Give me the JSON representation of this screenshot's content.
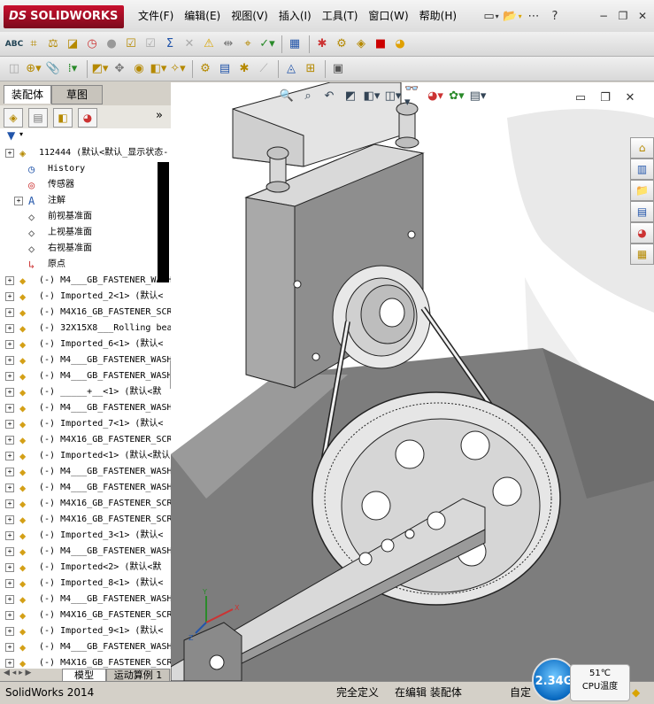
{
  "app": {
    "logo_prefix": "DS",
    "logo_text": "SOLIDWORKS"
  },
  "menus": [
    "文件(F)",
    "编辑(E)",
    "视图(V)",
    "插入(I)",
    "工具(T)",
    "窗口(W)",
    "帮助(H)"
  ],
  "title_tools": {
    "help": "?",
    "minimize": "−",
    "restore": "❐",
    "close": "✕"
  },
  "left_panel": {
    "tabs": [
      "装配体",
      "草图"
    ],
    "filter_icon": "filter-icon",
    "tree": [
      {
        "label": "112444  (默认<默认_显示状态-",
        "icon": "assembly-icon",
        "expand": "+"
      },
      {
        "label": "History",
        "icon": "history-icon",
        "expand": ""
      },
      {
        "label": "传感器",
        "icon": "sensor-icon",
        "expand": ""
      },
      {
        "label": "注解",
        "icon": "annotation-icon",
        "expand": "+"
      },
      {
        "label": "前视基准面",
        "icon": "plane-icon",
        "expand": ""
      },
      {
        "label": "上视基准面",
        "icon": "plane-icon",
        "expand": ""
      },
      {
        "label": "右视基准面",
        "icon": "plane-icon",
        "expand": ""
      },
      {
        "label": "原点",
        "icon": "origin-icon",
        "expand": ""
      },
      {
        "label": "(-) M4___GB_FASTENER_WASH",
        "icon": "part-icon",
        "expand": "+"
      },
      {
        "label": "(-) Imported_2<1> (默认<",
        "icon": "part-icon",
        "expand": "+"
      },
      {
        "label": "(-) M4X16_GB_FASTENER_SCR",
        "icon": "part-icon",
        "expand": "+"
      },
      {
        "label": "(-) 32X15X8___Rolling bea",
        "icon": "part-icon",
        "expand": "+"
      },
      {
        "label": "(-) Imported_6<1> (默认<",
        "icon": "part-icon",
        "expand": "+"
      },
      {
        "label": "(-) M4___GB_FASTENER_WASH",
        "icon": "part-icon",
        "expand": "+"
      },
      {
        "label": "(-) M4___GB_FASTENER_WASH",
        "icon": "part-icon",
        "expand": "+"
      },
      {
        "label": "(-) _____+__<1> (默认<默",
        "icon": "part-icon",
        "expand": "+"
      },
      {
        "label": "(-) M4___GB_FASTENER_WASH",
        "icon": "part-icon",
        "expand": "+"
      },
      {
        "label": "(-) Imported_7<1> (默认<",
        "icon": "part-icon",
        "expand": "+"
      },
      {
        "label": "(-) M4X16_GB_FASTENER_SCR",
        "icon": "part-icon",
        "expand": "+"
      },
      {
        "label": "(-) Imported<1> (默认<默认",
        "icon": "part-icon",
        "expand": "+"
      },
      {
        "label": "(-) M4___GB_FASTENER_WASH",
        "icon": "part-icon",
        "expand": "+"
      },
      {
        "label": "(-) M4___GB_FASTENER_WASH",
        "icon": "part-icon",
        "expand": "+"
      },
      {
        "label": "(-) M4X16_GB_FASTENER_SCR",
        "icon": "part-icon",
        "expand": "+"
      },
      {
        "label": "(-) M4X16_GB_FASTENER_SCR",
        "icon": "part-icon",
        "expand": "+"
      },
      {
        "label": "(-) Imported_3<1> (默认<",
        "icon": "part-icon",
        "expand": "+"
      },
      {
        "label": "(-) M4___GB_FASTENER_WASH",
        "icon": "part-icon",
        "expand": "+"
      },
      {
        "label": "(-) Imported<2> (默认<默",
        "icon": "part-icon",
        "expand": "+"
      },
      {
        "label": "(-) Imported_8<1> (默认<",
        "icon": "part-icon",
        "expand": "+"
      },
      {
        "label": "(-) M4___GB_FASTENER_WASH",
        "icon": "part-icon",
        "expand": "+"
      },
      {
        "label": "(-) M4X16_GB_FASTENER_SCR",
        "icon": "part-icon",
        "expand": "+"
      },
      {
        "label": "(-) Imported_9<1> (默认<",
        "icon": "part-icon",
        "expand": "+"
      },
      {
        "label": "(-) M4___GB_FASTENER_WASH",
        "icon": "part-icon",
        "expand": "+"
      },
      {
        "label": "(-) M4X16_GB_FASTENER_SCR",
        "icon": "part-icon",
        "expand": "+"
      }
    ]
  },
  "bottom_tabs": [
    "模型",
    "运动算例 1"
  ],
  "status": {
    "app_version": "SolidWorks 2014",
    "constraint": "完全定义",
    "mode": "在编辑 装配体",
    "units": "自定"
  },
  "perf_widget": {
    "value": "2.34G",
    "temp": "51℃",
    "label": "CPU温度"
  },
  "colors": {
    "accent": "#c8102e",
    "tree_part": "#d4a017",
    "viewport_bg": "#ffffff",
    "model_gray": "#8c8c8c"
  }
}
